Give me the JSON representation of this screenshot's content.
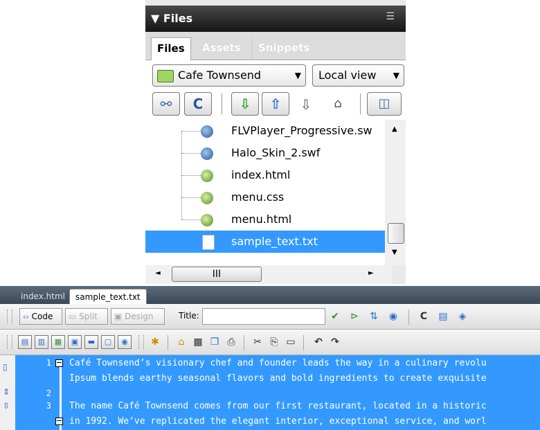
{
  "files_panel": {
    "title": "▼ Files",
    "options_icon": "panel-options-icon",
    "tabs": [
      "Files",
      "Assets",
      "Snippets"
    ],
    "site": "Cafe Townsend",
    "view": "Local view",
    "files": [
      {
        "name": "FLVPlayer_Progressive.sw",
        "icon": "swf-file-icon"
      },
      {
        "name": "Halo_Skin_2.swf",
        "icon": "swf-file-icon"
      },
      {
        "name": "index.html",
        "icon": "html-file-icon"
      },
      {
        "name": "menu.css",
        "icon": "css-file-icon"
      },
      {
        "name": "menu.html",
        "icon": "html-file-icon"
      },
      {
        "name": "sample_text.txt",
        "icon": "text-file-icon",
        "selected": true
      }
    ],
    "hscroll_label": "III"
  },
  "document": {
    "tabs": [
      "index.html",
      "sample_text.txt"
    ],
    "active_tab": "sample_text.txt",
    "view_buttons": [
      "Code",
      "Split",
      "Design"
    ],
    "title_label": "Title:",
    "title_value": "",
    "lines": [
      {
        "num": "1",
        "text": "Café Townsend’s visionary chef and founder leads the way in a culinary revolu"
      },
      {
        "num": "",
        "text": "Ipsum blends earthy seasonal flavors and bold ingredients to create exquisite"
      },
      {
        "num": "2",
        "text": ""
      },
      {
        "num": "3",
        "text": "The name Café Townsend comes from our first restaurant, located in a historic"
      },
      {
        "num": "",
        "text": "in 1992. We’ve replicated the elegant interior, exceptional service, and worl"
      }
    ]
  },
  "colors": {
    "selection": "#3399ff",
    "tab_bar": "#4b5868"
  }
}
